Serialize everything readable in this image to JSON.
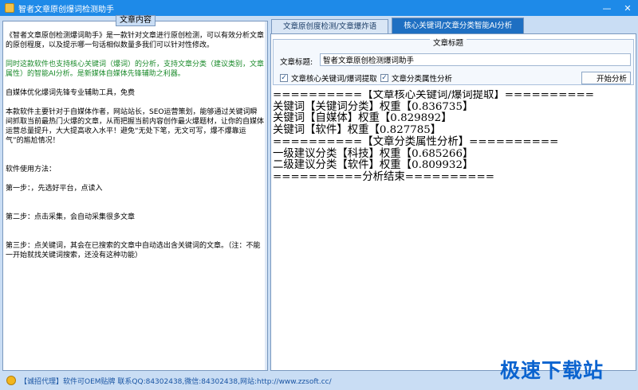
{
  "window": {
    "title": "智者文章原创爆词检测助手",
    "minimize": "—",
    "close": "✕"
  },
  "left": {
    "legend": "文章内容",
    "paragraphs": [
      {
        "text": "《智者文章原创检测爆词助手》是一款针对文章进行原创检测，可以有效分析文章的原创程度，以及提示哪一句话相似数量多我们可以针对性修改。",
        "green": false
      },
      {
        "text": "",
        "green": false
      },
      {
        "text": "同时这款软件也支持核心关键词（爆词）的分析，支持文章分类（建议类别，文章属性）的智能AI分析。是新媒体自媒体先锋辅助之利器。",
        "green": true
      },
      {
        "text": "",
        "green": false
      },
      {
        "text": "自媒体优化爆词先锋专业辅助工具，免费",
        "green": false
      },
      {
        "text": "",
        "green": false
      },
      {
        "text": "本款软件主要针对于自媒体作者，网站站长，SEO运营策划，能够通过关键词瞬间抓取当前最热门火爆的文章，从而把握当前内容创作最火爆题材，让你的自媒体运营总量提升，大大提高收入水平！避免“无处下笔，无文可写，爆不爆靠运气”的尴尬情况！",
        "green": false
      },
      {
        "text": "",
        "green": false
      },
      {
        "text": "",
        "green": false
      },
      {
        "text": "软件使用方法：",
        "green": false
      },
      {
        "text": "",
        "green": false
      },
      {
        "text": "第一步：，先选好平台，点读入",
        "green": false
      },
      {
        "text": "",
        "green": false
      },
      {
        "text": "",
        "green": false
      },
      {
        "text": "第二步：点击采集，会自动采集很多文章",
        "green": false
      },
      {
        "text": "",
        "green": false
      },
      {
        "text": "",
        "green": false
      },
      {
        "text": "第三步：点关键词，其会在已搜索的文章中自动选出含关键词的文章。（注：不能一开始就找关键词搜索，还没有这种功能）",
        "green": false
      }
    ]
  },
  "tabs": [
    {
      "label": "文章原创度检测/文章爆炸语",
      "active": false
    },
    {
      "label": "核心关键词/文章分类智能AI分析",
      "active": true
    }
  ],
  "right": {
    "group_legend": "文章标题",
    "title_label": "文章标题:",
    "title_value": "智者文章原创检测爆词助手",
    "checkbox1": "文章核心关键词/爆词提取",
    "checkbox2": "文章分类属性分析",
    "start_button": "开始分析",
    "output_lines": [
      "==========【文章核心关键词/爆词提取】==========",
      "关键词【关键词分类】权重【0.836735】",
      "关键词【自媒体】权重【0.829892】",
      "关键词【软件】权重【0.827785】",
      "==========【文章分类属性分析】==========",
      "一级建议分类【科技】权重【0.685266】",
      "二级建议分类【软件】权重【0.809932】",
      "==========分析结束=========="
    ]
  },
  "status": {
    "text": "【诚招代理】软件可OEM贴牌 联系QQ:84302438,微信:84302438,网站:http://www.zzsoft.cc/"
  },
  "watermark": "极速下载站"
}
